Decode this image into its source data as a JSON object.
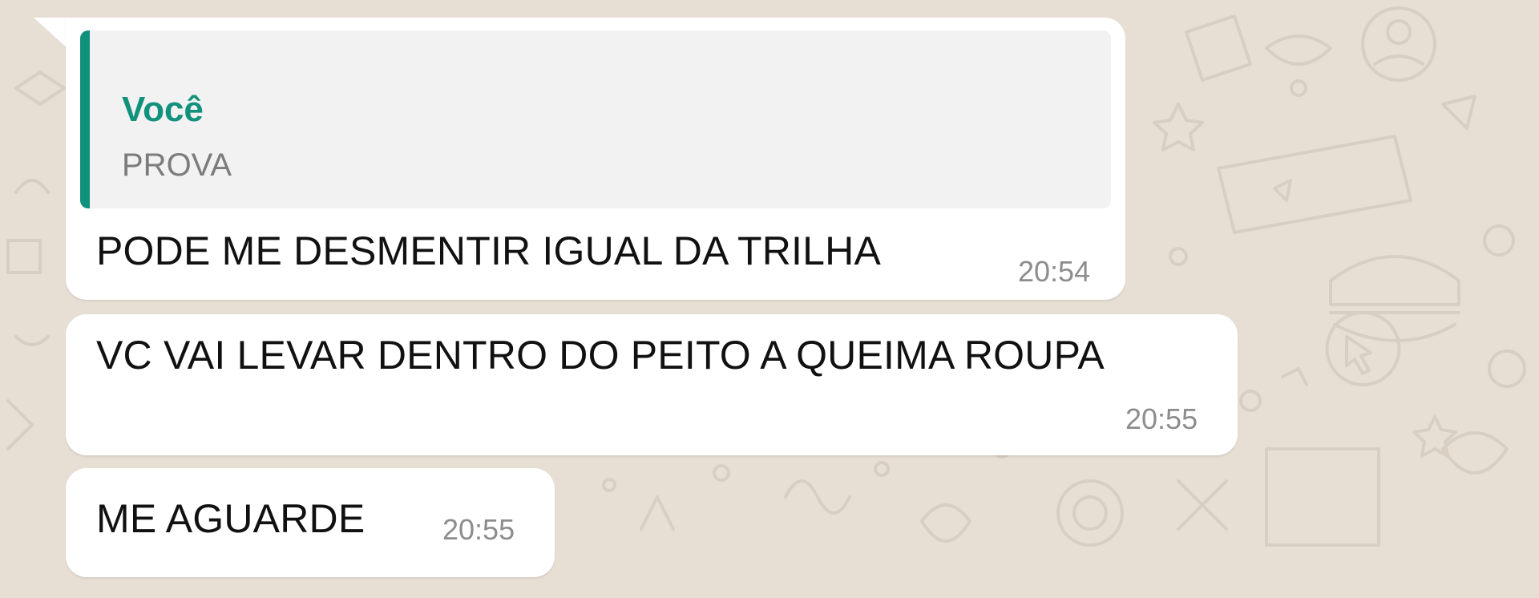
{
  "app": {
    "name": "WhatsApp chat",
    "colors": {
      "wallpaper": "#e7dfd4",
      "bubble": "#ffffff",
      "quote_accent": "#10917c",
      "quote_bg": "#f2f2f2",
      "time_text": "#8d8d8d"
    }
  },
  "messages": [
    {
      "quoted": {
        "author": "Você",
        "text": "PROVA"
      },
      "text": "PODE ME DESMENTIR IGUAL DA TRILHA",
      "time": "20:54"
    },
    {
      "text": "VC VAI LEVAR DENTRO DO PEITO A QUEIMA ROUPA",
      "time": "20:55"
    },
    {
      "text": "ME AGUARDE",
      "time": "20:55"
    }
  ]
}
